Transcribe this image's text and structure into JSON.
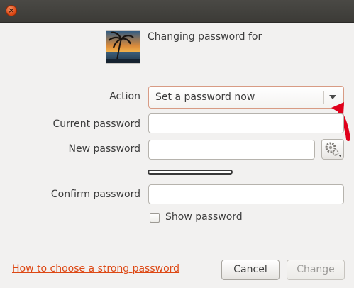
{
  "window": {
    "close_label": "×"
  },
  "header": {
    "title": "Changing password for",
    "avatar": "user-avatar-photo"
  },
  "form": {
    "action_label": "Action",
    "action_value": "Set a password now",
    "current_password_label": "Current password",
    "current_password_value": "",
    "new_password_label": "New password",
    "new_password_value": "",
    "confirm_password_label": "Confirm password",
    "confirm_password_value": "",
    "show_password_label": "Show password",
    "show_password_checked": false
  },
  "footer": {
    "help_link": "How to choose a strong password",
    "cancel_label": "Cancel",
    "change_label": "Change"
  },
  "colors": {
    "accent": "#dd4814",
    "annotation_arrow": "#e0001b",
    "titlebar": "#3c3b37"
  }
}
